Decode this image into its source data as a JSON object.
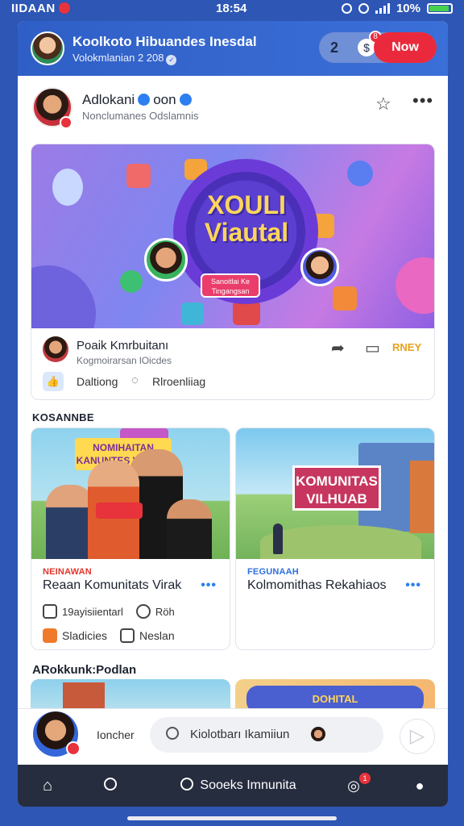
{
  "status_bar": {
    "carrier": "IIDAAN",
    "time": "18:54",
    "battery": "10%"
  },
  "header": {
    "title": "Koolkoto Hibuandes Inesdal",
    "subtitle": "Volokmlanian 2 208",
    "count": "2",
    "money_icon": "$",
    "now_label": "Now",
    "badge": "8"
  },
  "post": {
    "author": "Adlokani",
    "author_suffix": "oon",
    "meta": "Nonclumanes Odslamnis"
  },
  "banner": {
    "headline_1": "XOULI",
    "headline_2": "Viautal",
    "tag": "Sanoitlai Ke Tingangsan"
  },
  "card_footer": {
    "name": "Poaik Kmrbuitanı",
    "meta": "Kogmoirarsan lOicdes",
    "gold_label": "RNEY",
    "like_label": "Daltiong",
    "comment_label": "Rlroenliiag"
  },
  "section_title": "KOSANNBE",
  "cards": [
    {
      "category": "NEINAWAN",
      "title": "Reaan Komunitats Virak",
      "sign": "NOMIHAITAN KANUNTES VIODAB",
      "stat1": "19ayisiientarl",
      "stat2": "Röh",
      "link": "Sladicies",
      "link2": "Neslan"
    },
    {
      "category": "FEGUNAAH",
      "title": "Kolmomithas Rekahiaos",
      "sign": "KOMUNITAS VILHUAB"
    }
  ],
  "section2_title": "ARokkunk:Podlan",
  "peek": {
    "b_text": "DOHITAL"
  },
  "composer": {
    "label": "Ioncher",
    "search_placeholder": "Kiolotbarı Ikamiiun"
  },
  "tabbar": {
    "middle_label": "Sooeks Imnunita",
    "notif_badge": "1"
  }
}
